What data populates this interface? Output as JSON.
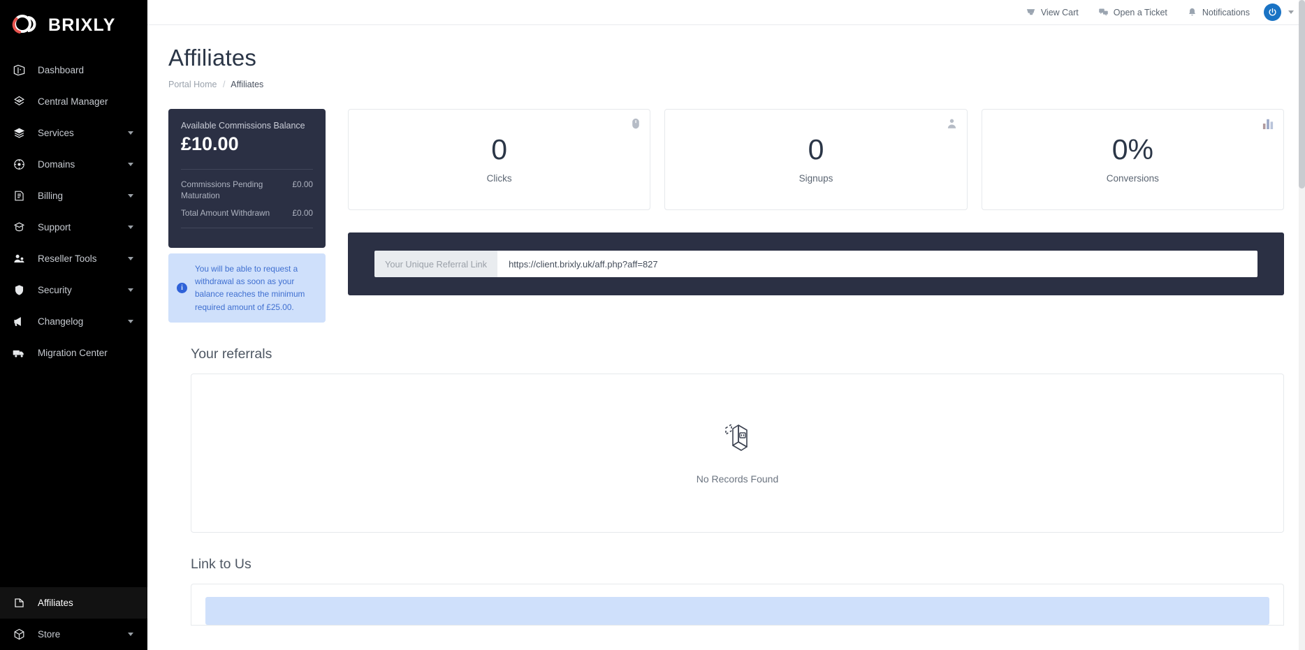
{
  "brand": {
    "name": "BRIXLY",
    "accent": "#e8544f",
    "sidebar_bg": "#000000"
  },
  "sidebar": {
    "items": [
      {
        "label": "Dashboard",
        "icon": "dashboard-icon",
        "caret": false,
        "active": false
      },
      {
        "label": "Central Manager",
        "icon": "central-manager-icon",
        "caret": false,
        "active": false
      },
      {
        "label": "Services",
        "icon": "services-icon",
        "caret": true,
        "active": false
      },
      {
        "label": "Domains",
        "icon": "domains-icon",
        "caret": true,
        "active": false
      },
      {
        "label": "Billing",
        "icon": "billing-icon",
        "caret": true,
        "active": false
      },
      {
        "label": "Support",
        "icon": "support-icon",
        "caret": true,
        "active": false
      },
      {
        "label": "Reseller Tools",
        "icon": "reseller-tools-icon",
        "caret": true,
        "active": false
      },
      {
        "label": "Security",
        "icon": "shield-icon",
        "caret": true,
        "active": false
      },
      {
        "label": "Changelog",
        "icon": "megaphone-icon",
        "caret": true,
        "active": false
      },
      {
        "label": "Migration Center",
        "icon": "truck-icon",
        "caret": false,
        "active": false
      }
    ],
    "bottom_items": [
      {
        "label": "Affiliates",
        "icon": "affiliates-icon",
        "caret": false,
        "active": true
      },
      {
        "label": "Store",
        "icon": "store-icon",
        "caret": true,
        "active": false
      }
    ]
  },
  "topbar": {
    "links": [
      {
        "label": "View Cart",
        "icon": "cart-icon"
      },
      {
        "label": "Open a Ticket",
        "icon": "ticket-icon"
      },
      {
        "label": "Notifications",
        "icon": "bell-icon"
      }
    ],
    "power_icon": "power-icon",
    "power_color": "#1a73c4",
    "caret_icon": "chevron-down-icon"
  },
  "page": {
    "title": "Affiliates",
    "breadcrumb": {
      "home": "Portal Home",
      "separator": "/",
      "current": "Affiliates"
    }
  },
  "balance_card": {
    "label": "Available Commissions Balance",
    "amount": "£10.00",
    "rows": [
      {
        "key": "Commissions Pending Maturation",
        "value": "£0.00"
      },
      {
        "key": "Total Amount Withdrawn",
        "value": "£0.00"
      }
    ]
  },
  "info_alert": {
    "icon": "info-icon",
    "text": "You will be able to request a withdrawal as soon as your balance reaches the minimum required amount of £25.00."
  },
  "stats": [
    {
      "value": "0",
      "label": "Clicks",
      "icon": "mouse-icon"
    },
    {
      "value": "0",
      "label": "Signups",
      "icon": "person-icon"
    },
    {
      "value": "0%",
      "label": "Conversions",
      "icon": "bar-chart-icon"
    }
  ],
  "referral": {
    "addon_label": "Your Unique Referral Link",
    "url": "https://client.brixly.uk/aff.php?aff=827",
    "placeholder": "Your Unique Referral Link"
  },
  "referrals_section": {
    "title": "Your referrals",
    "empty_icon": "empty-box-icon",
    "empty_text": "No Records Found"
  },
  "link_to_us": {
    "title": "Link to Us"
  }
}
